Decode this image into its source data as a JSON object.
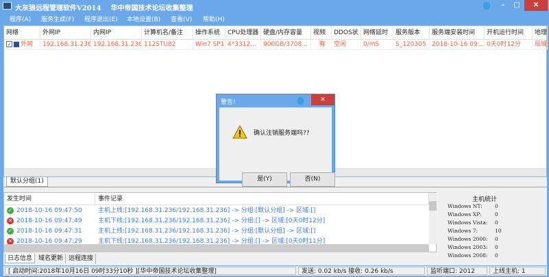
{
  "window": {
    "title": "大灰狼远程管理软件V2014    华中帝国技术论坛收集整理",
    "minimize": "–",
    "maximize": "□",
    "close": "✕"
  },
  "menu": [
    "程序(A)",
    "服务生成(F)",
    "程序退出(E)",
    "本地设置(B)",
    "查看(V)",
    "帮助(H)"
  ],
  "table": {
    "columns": [
      "网络",
      "外网IP",
      "内网IP",
      "计算机名/备注",
      "操作系统",
      "CPU处理器",
      "硬盘/内存容量",
      "视频",
      "DDOS状",
      "网络延时",
      "服务版本",
      "服务端安装时间",
      "开机运行时间",
      "地理"
    ],
    "rows": [
      [
        "外网",
        "192.168.31.236",
        "192.168.31.236",
        "112STU82",
        "Win7 SP1",
        "4*3312...",
        "900GB/3708...",
        "有",
        "空闲",
        "0/mS",
        "S_120305",
        "2018-10-16 09:...",
        "0天0时12分",
        "局域"
      ]
    ],
    "row_checked": true
  },
  "group_tab": "默认分组(1)",
  "log": {
    "columns": [
      "发生时间",
      "事件记录"
    ],
    "rows": [
      {
        "status": "online",
        "time": "2018-10-16 09:47:50",
        "event": "主机上线:[192.168.31.236/192.168.31.236] -> 分组:[默认分组] -> 区域:[]"
      },
      {
        "status": "offline",
        "time": "2018-10-16 09:47:49",
        "event": "主机下线:[192.168.31.236/192.168.31.236] -> 分组:[] -> 区域:[0天0时12分]"
      },
      {
        "status": "online",
        "time": "2018-10-16 09:47:31",
        "event": "主机上线:[192.168.31.236/192.168.31.236] -> 分组:[默认分组] -> 区域:[]"
      },
      {
        "status": "offline",
        "time": "2018-10-16 09:47:29",
        "event": "主机下线:[192.168.31.236/192.168.31.236] -> 分组:[] -> 区域:[0天0时11分]"
      }
    ]
  },
  "bottom_tabs": [
    "日志信息",
    "域名更新",
    "远程连接"
  ],
  "stats": {
    "title": "主机统计",
    "items": [
      [
        "Windows NT:",
        "0"
      ],
      [
        "Windows XP:",
        "0"
      ],
      [
        "Windows Vista:",
        "0"
      ],
      [
        "Windows 7:",
        "10"
      ],
      [
        "Windows 2000:",
        "0"
      ],
      [
        "Windows 2003:",
        "0"
      ],
      [
        "Windows 2008:",
        "0"
      ]
    ]
  },
  "status": {
    "start": "[ 启动时间:2018年10月16日 09时33分10秒 ][华中帝国技术论坛收集整理]",
    "traffic": "发送: 0.02 kb/s 接收: 0.26 kb/s",
    "port": "监听端口: 2012",
    "online": "上线主机: 1"
  },
  "dialog": {
    "title": "警告!",
    "message": "确认注销服务端吗??",
    "yes": "是(Y)",
    "no": "否(N)",
    "close": "✕"
  },
  "colors": {
    "titlebar": "#6aa8ea",
    "row_text": "#f0603c",
    "log_text": "#3a7be0",
    "close": "#c9403a"
  }
}
